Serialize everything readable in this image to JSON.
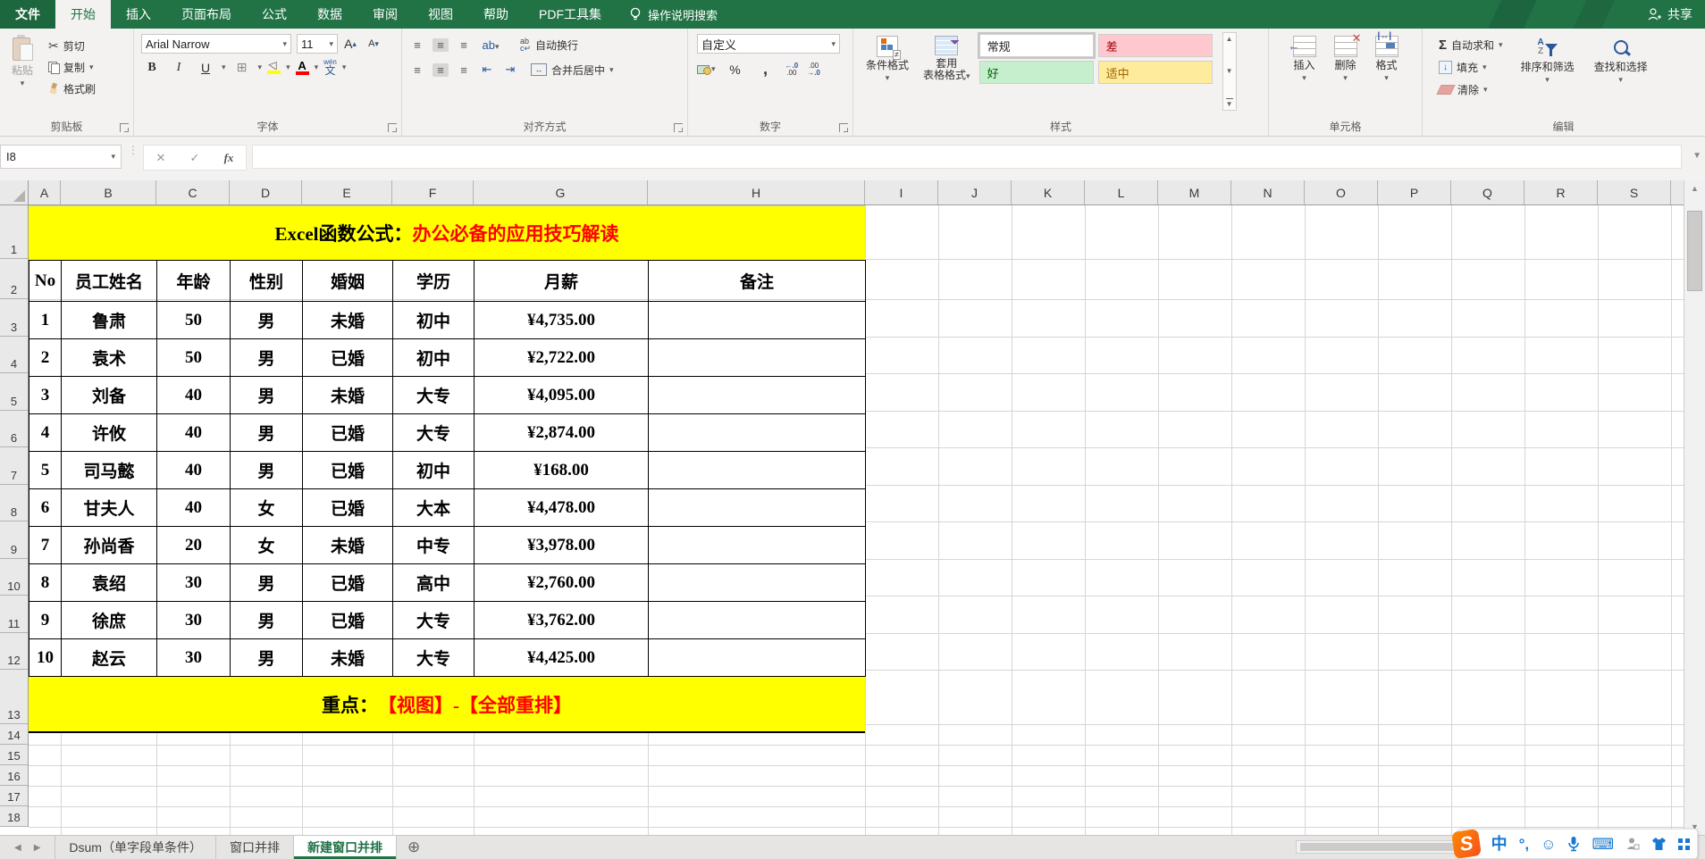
{
  "colors": {
    "accent_green": "#217346",
    "banner_yellow": "#ffff00",
    "banner_red": "#ff0000"
  },
  "titlebar": {
    "file_tab": "文件",
    "tabs": [
      "开始",
      "插入",
      "页面布局",
      "公式",
      "数据",
      "审阅",
      "视图",
      "帮助",
      "PDF工具集"
    ],
    "active_tab": "开始",
    "search_label": "操作说明搜索",
    "share_label": "共享"
  },
  "ribbon": {
    "clipboard": {
      "label": "剪贴板",
      "paste": "粘贴",
      "cut": "剪切",
      "copy": "复制",
      "format_painter": "格式刷"
    },
    "font": {
      "label": "字体",
      "name": "Arial Narrow",
      "size": "11",
      "phonetic": "文",
      "phonetic_pinyin": "wén"
    },
    "alignment": {
      "label": "对齐方式",
      "wrap": "自动换行",
      "merge": "合并后居中"
    },
    "number": {
      "label": "数字",
      "format": "自定义"
    },
    "styles": {
      "label": "样式",
      "conditional": "条件格式",
      "table_line1": "套用",
      "table_line2": "表格格式",
      "gallery": [
        {
          "label": "常规",
          "bg": "#ffffff",
          "color": "#1f1f1f"
        },
        {
          "label": "差",
          "bg": "#ffc7ce",
          "color": "#9c0006"
        },
        {
          "label": "好",
          "bg": "#c6efce",
          "color": "#006100"
        },
        {
          "label": "适中",
          "bg": "#ffeb9c",
          "color": "#9c6500"
        }
      ]
    },
    "cells": {
      "label": "单元格",
      "insert": "插入",
      "delete": "删除",
      "format": "格式"
    },
    "editing": {
      "label": "编辑",
      "autosum": "自动求和",
      "fill": "填充",
      "clear": "清除",
      "sort": "排序和筛选",
      "find": "查找和选择"
    }
  },
  "formula_bar": {
    "name_box": "I8",
    "formula": ""
  },
  "grid": {
    "columns": [
      "A",
      "B",
      "C",
      "D",
      "E",
      "F",
      "G",
      "H",
      "I",
      "J",
      "K",
      "L",
      "M",
      "N",
      "O",
      "P",
      "Q",
      "R",
      "S"
    ],
    "rows": [
      "1",
      "2",
      "3",
      "4",
      "5",
      "6",
      "7",
      "8",
      "9",
      "10",
      "11",
      "12",
      "13",
      "14",
      "15",
      "16",
      "17",
      "18"
    ],
    "title_black": "Excel函数公式：",
    "title_red": "办公必备的应用技巧解读",
    "footer_black": "重点：",
    "footer_red": "【视图】-【全部重排】",
    "table": {
      "headers": [
        "No",
        "员工姓名",
        "年龄",
        "性别",
        "婚姻",
        "学历",
        "月薪",
        "备注"
      ],
      "rows": [
        [
          "1",
          "鲁肃",
          "50",
          "男",
          "未婚",
          "初中",
          "¥4,735.00",
          ""
        ],
        [
          "2",
          "袁术",
          "50",
          "男",
          "已婚",
          "初中",
          "¥2,722.00",
          ""
        ],
        [
          "3",
          "刘备",
          "40",
          "男",
          "未婚",
          "大专",
          "¥4,095.00",
          ""
        ],
        [
          "4",
          "许攸",
          "40",
          "男",
          "已婚",
          "大专",
          "¥2,874.00",
          ""
        ],
        [
          "5",
          "司马懿",
          "40",
          "男",
          "已婚",
          "初中",
          "¥168.00",
          ""
        ],
        [
          "6",
          "甘夫人",
          "40",
          "女",
          "已婚",
          "大本",
          "¥4,478.00",
          ""
        ],
        [
          "7",
          "孙尚香",
          "20",
          "女",
          "未婚",
          "中专",
          "¥3,978.00",
          ""
        ],
        [
          "8",
          "袁绍",
          "30",
          "男",
          "已婚",
          "高中",
          "¥2,760.00",
          ""
        ],
        [
          "9",
          "徐庶",
          "30",
          "男",
          "已婚",
          "大专",
          "¥3,762.00",
          ""
        ],
        [
          "10",
          "赵云",
          "30",
          "男",
          "未婚",
          "大专",
          "¥4,425.00",
          ""
        ]
      ]
    }
  },
  "sheet_bar": {
    "tabs": [
      "Dsum（单字段单条件）",
      "窗口并排",
      "新建窗口并排"
    ],
    "active_tab": "新建窗口并排"
  },
  "ime": {
    "brand": "S",
    "mode": "中",
    "punct": "°,"
  },
  "icons": {
    "dropdown": "▾",
    "cut": "✂",
    "bold": "B",
    "italic": "I",
    "underline": "U",
    "border": "⊞",
    "sum": "Σ",
    "fill_arrow": "↓",
    "wrap_ab": "ab",
    "wrap_return": "↵",
    "merge_arrows": "↔",
    "percent": "%",
    "comma": ",",
    "dec_left_top": "←.0",
    "dec_left_bot": ".00",
    "dec_right_top": ".00",
    "dec_right_bot": "→.0",
    "fx": "fx",
    "cancel": "✕",
    "enter": "✓",
    "plus_tab": "⊕",
    "up": "▲",
    "down": "▼",
    "left": "◀",
    "right": "▶",
    "align_lines": "≡",
    "indent_dec": "⇤",
    "indent_inc": "⇥",
    "ne": "≠",
    "smiley": "☺",
    "keyboard": "⌨",
    "grow_a": "A",
    "shrink_a": "A",
    "sort_a": "A",
    "sort_z": "Z",
    "font_a": "A",
    "rotate_ab": "ab⤴"
  }
}
